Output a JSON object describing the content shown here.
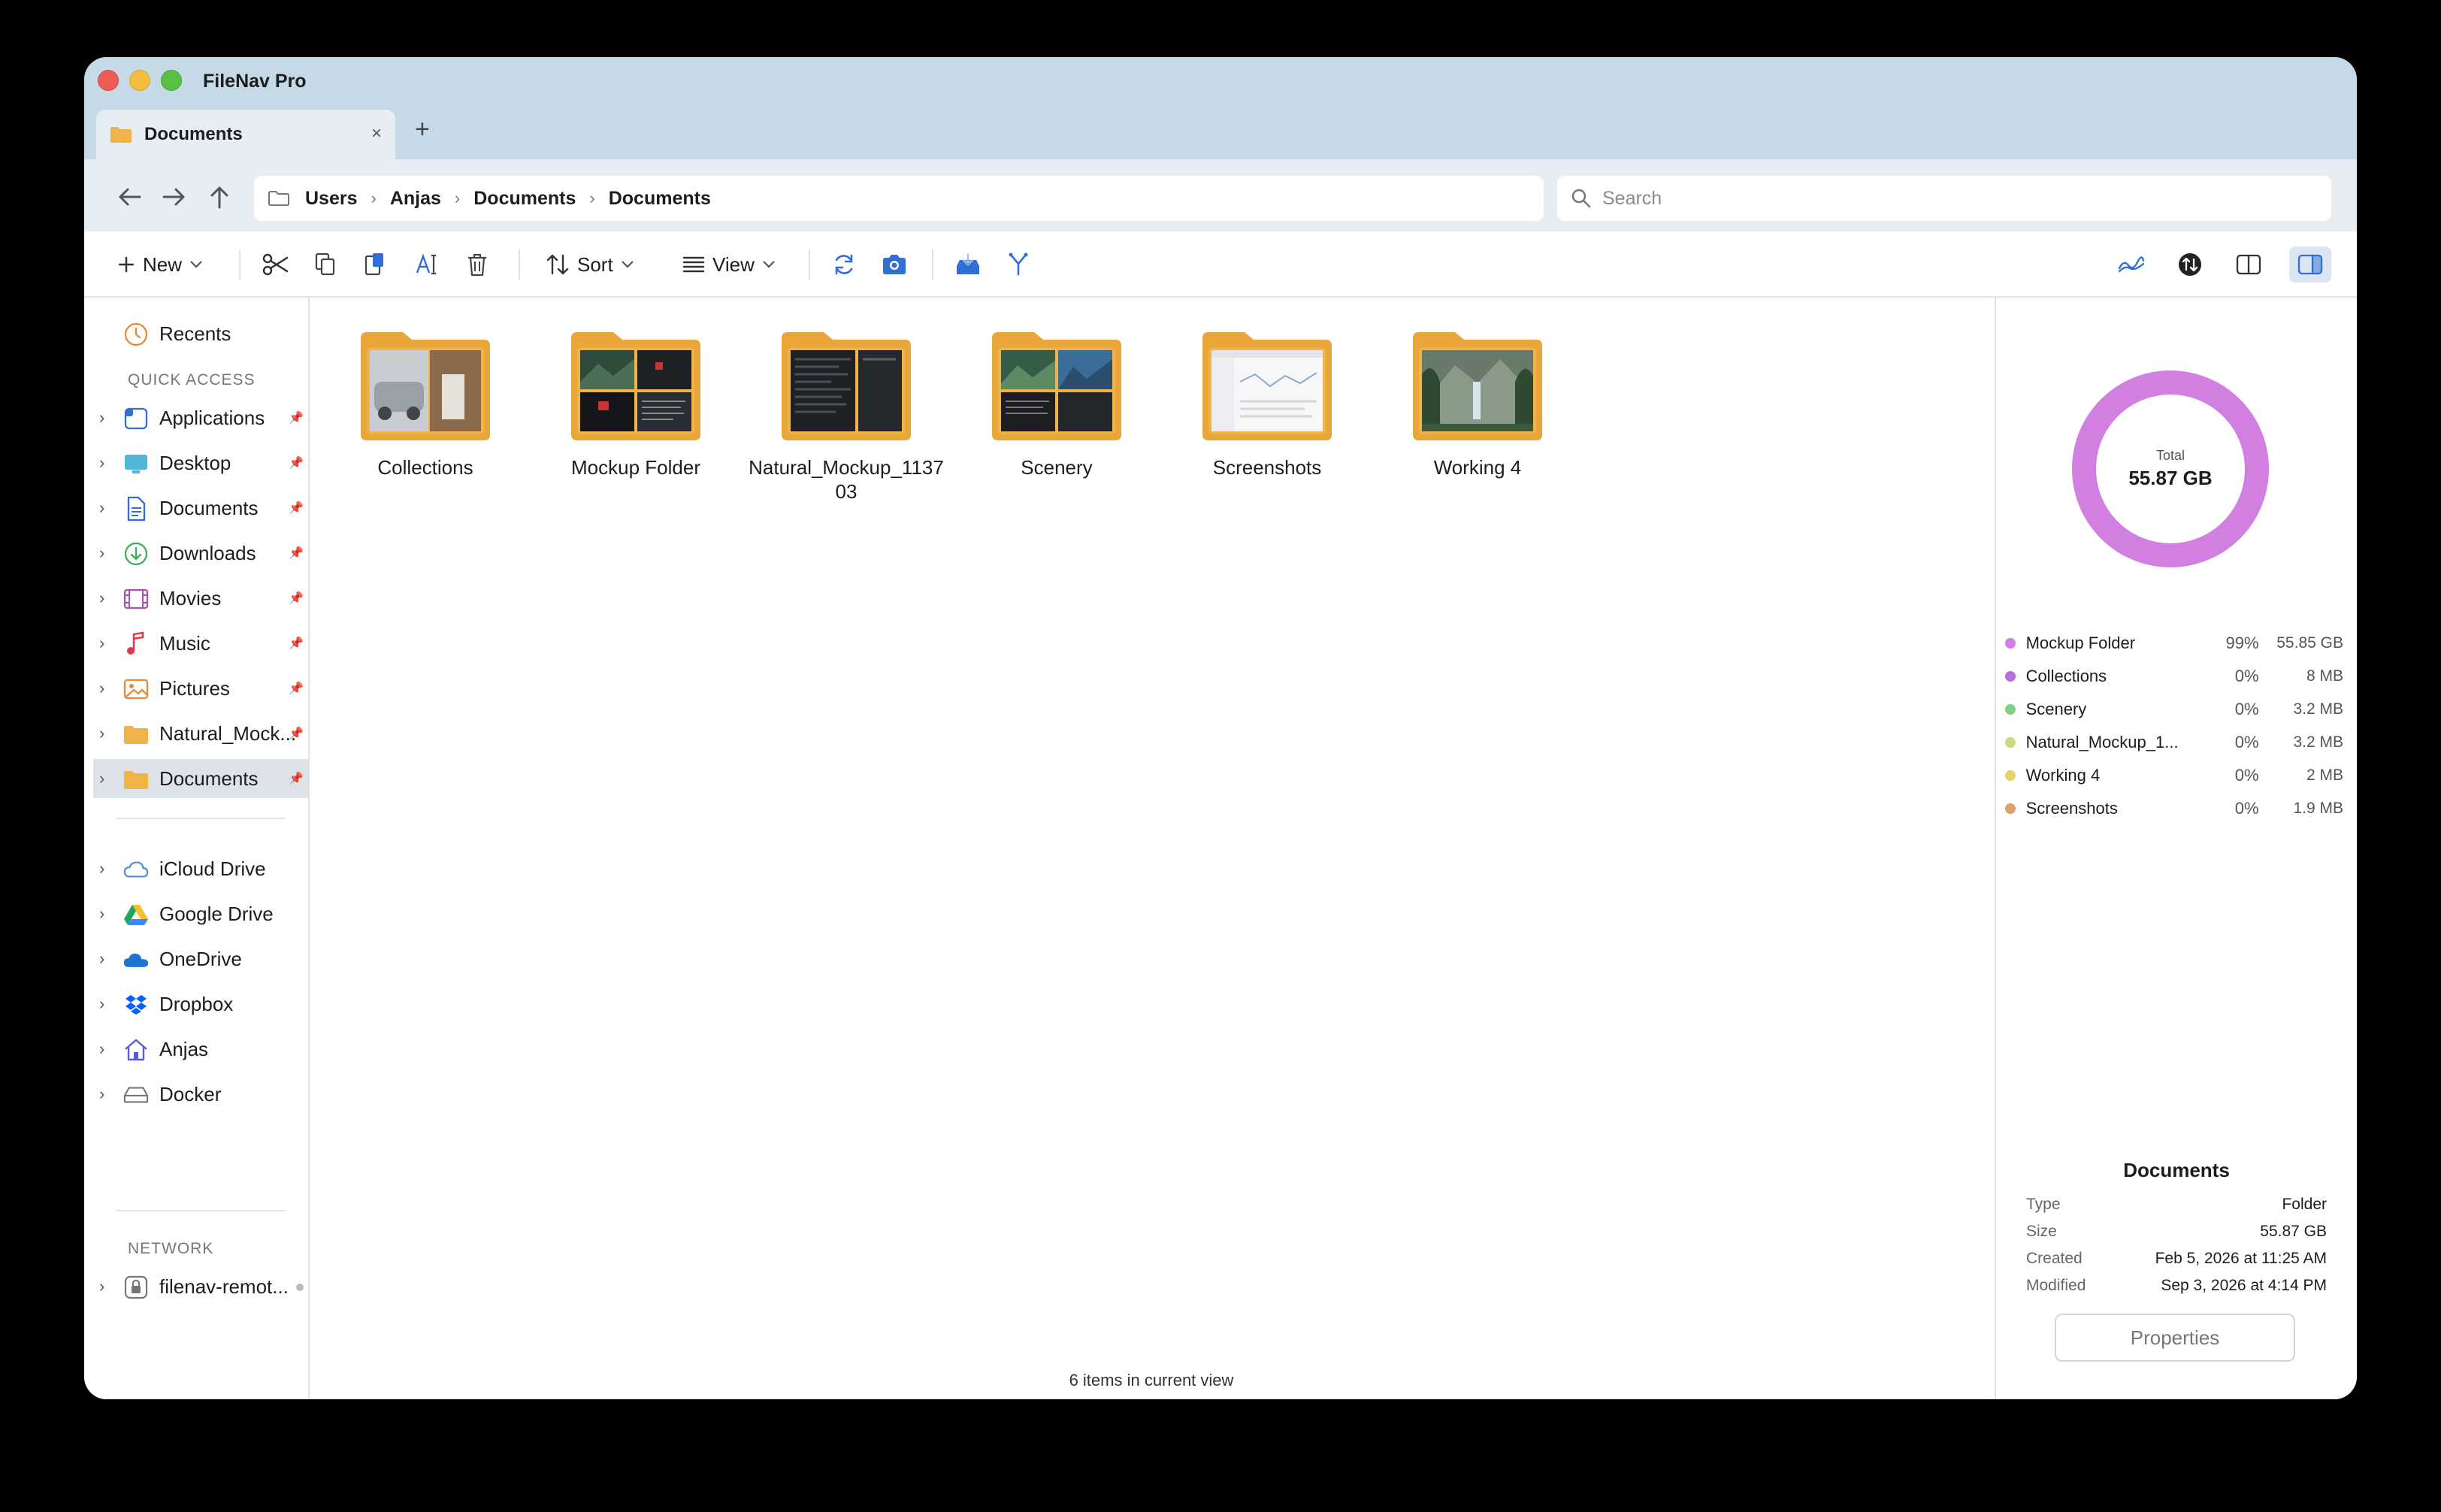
{
  "app": {
    "title": "FileNav Pro"
  },
  "tab": {
    "label": "Documents",
    "close": "×",
    "new_tab": "+"
  },
  "breadcrumb": [
    "Users",
    "Anjas",
    "Documents",
    "Documents"
  ],
  "search": {
    "placeholder": "Search",
    "value": ""
  },
  "toolbar": {
    "new_label": "New",
    "sort_label": "Sort",
    "view_label": "View"
  },
  "sidebar": {
    "recents": "Recents",
    "quick_access_heading": "QUICK ACCESS",
    "quick_access": [
      {
        "label": "Applications"
      },
      {
        "label": "Desktop"
      },
      {
        "label": "Documents"
      },
      {
        "label": "Downloads"
      },
      {
        "label": "Movies"
      },
      {
        "label": "Music"
      },
      {
        "label": "Pictures"
      },
      {
        "label": "Natural_Mock..."
      },
      {
        "label": "Documents"
      }
    ],
    "locations": [
      {
        "label": "iCloud Drive"
      },
      {
        "label": "Google Drive"
      },
      {
        "label": "OneDrive"
      },
      {
        "label": "Dropbox"
      },
      {
        "label": "Anjas"
      },
      {
        "label": "Docker"
      }
    ],
    "network_heading": "NETWORK",
    "network": [
      {
        "label": "filenav-remot..."
      }
    ]
  },
  "files": [
    {
      "name": "Collections"
    },
    {
      "name": "Mockup Folder"
    },
    {
      "name": "Natural_Mockup_113703"
    },
    {
      "name": "Scenery"
    },
    {
      "name": "Screenshots"
    },
    {
      "name": "Working 4"
    }
  ],
  "status": {
    "text": "6 items in current view"
  },
  "panel": {
    "total_label": "Total",
    "total_value": "55.87 GB",
    "breakdown": [
      {
        "name": "Mockup Folder",
        "percent": "99%",
        "size": "55.85 GB",
        "color": "#d17fe0"
      },
      {
        "name": "Collections",
        "percent": "0%",
        "size": "8 MB",
        "color": "#b96ee0"
      },
      {
        "name": "Scenery",
        "percent": "0%",
        "size": "3.2 MB",
        "color": "#7fd18a"
      },
      {
        "name": "Natural_Mockup_1...",
        "percent": "0%",
        "size": "3.2 MB",
        "color": "#c9dc7a"
      },
      {
        "name": "Working 4",
        "percent": "0%",
        "size": "2 MB",
        "color": "#e6d26a"
      },
      {
        "name": "Screenshots",
        "percent": "0%",
        "size": "1.9 MB",
        "color": "#e0a06a"
      }
    ],
    "info": {
      "title": "Documents",
      "rows": [
        {
          "key": "Type",
          "value": "Folder"
        },
        {
          "key": "Size",
          "value": "55.87 GB"
        },
        {
          "key": "Created",
          "value": "Feb 5, 2026 at 11:25 AM"
        },
        {
          "key": "Modified",
          "value": "Sep 3, 2026 at 4:14 PM"
        }
      ]
    },
    "properties_label": "Properties"
  },
  "colors": {
    "folder": "#f0b347",
    "accent": "#2f6fd6",
    "titlebar": "#c6d9e6"
  }
}
